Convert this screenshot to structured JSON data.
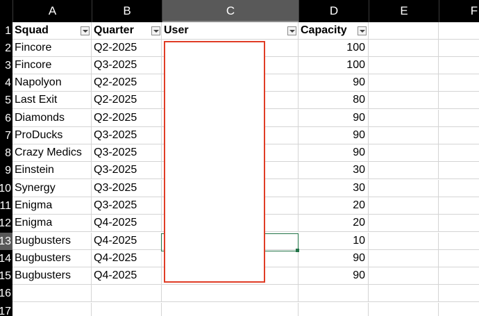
{
  "columns": [
    "A",
    "B",
    "C",
    "D",
    "E",
    "F"
  ],
  "selected_column": "C",
  "rows": [
    "1",
    "2",
    "3",
    "4",
    "5",
    "6",
    "7",
    "8",
    "9",
    "10",
    "11",
    "12",
    "13",
    "14",
    "15",
    "16",
    "17"
  ],
  "selected_row": "13",
  "header": {
    "squad": "Squad",
    "quarter": "Quarter",
    "user": "User",
    "capacity": "Capacity"
  },
  "data": [
    {
      "squad": "Fincore",
      "quarter": "Q2-2025",
      "capacity": "100"
    },
    {
      "squad": "Fincore",
      "quarter": "Q3-2025",
      "capacity": "100"
    },
    {
      "squad": "Napolyon",
      "quarter": "Q2-2025",
      "capacity": "90"
    },
    {
      "squad": "Last Exit",
      "quarter": "Q2-2025",
      "capacity": "80"
    },
    {
      "squad": "Diamonds",
      "quarter": "Q2-2025",
      "capacity": "90"
    },
    {
      "squad": "ProDucks",
      "quarter": "Q3-2025",
      "capacity": "90"
    },
    {
      "squad": "Crazy Medics",
      "quarter": "Q3-2025",
      "capacity": "90"
    },
    {
      "squad": "Einstein",
      "quarter": "Q3-2025",
      "capacity": "30"
    },
    {
      "squad": "Synergy",
      "quarter": "Q3-2025",
      "capacity": "30"
    },
    {
      "squad": "Enigma",
      "quarter": "Q3-2025",
      "capacity": "20"
    },
    {
      "squad": "Enigma",
      "quarter": "Q4-2025",
      "capacity": "20"
    },
    {
      "squad": "Bugbusters",
      "quarter": "Q4-2025",
      "capacity": "10"
    },
    {
      "squad": "Bugbusters",
      "quarter": "Q4-2025",
      "capacity": "90"
    },
    {
      "squad": "Bugbusters",
      "quarter": "Q4-2025",
      "capacity": "90"
    }
  ],
  "colors": {
    "header_bg": "#000000",
    "selected_header_bg": "#595959",
    "gridline": "#d4d4d4",
    "active_cell_border": "#217346",
    "redaction_border": "#e03c25"
  }
}
